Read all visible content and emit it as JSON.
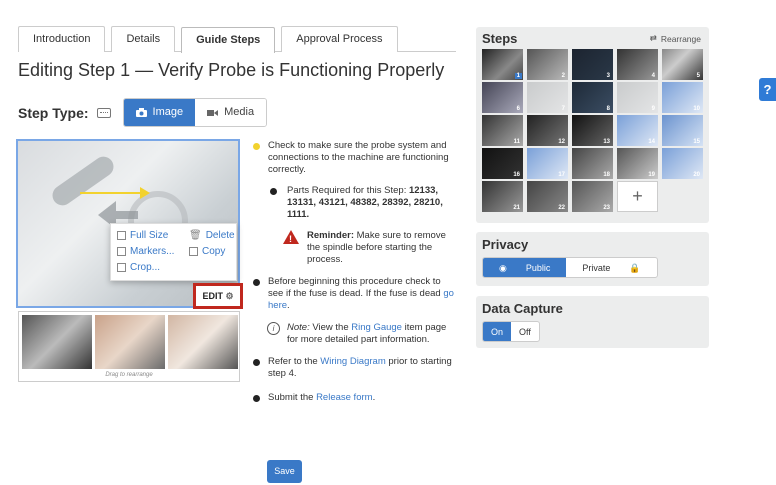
{
  "tabs": [
    {
      "label": "Introduction"
    },
    {
      "label": "Details"
    },
    {
      "label": "Guide Steps",
      "active": true
    },
    {
      "label": "Approval Process"
    }
  ],
  "title": "Editing Step 1 — Verify Probe is Functioning Properly",
  "step_type": {
    "label": "Step Type:",
    "options": [
      {
        "label": "Image",
        "selected": true
      },
      {
        "label": "Media",
        "selected": false
      }
    ]
  },
  "image_menu": {
    "full_size": "Full Size",
    "delete": "Delete",
    "markers": "Markers...",
    "copy": "Copy",
    "crop": "Crop...",
    "edit": "EDIT"
  },
  "drag_hint": "Drag to rearrange",
  "content": {
    "b1": "Check to make sure the probe system and connections to the machine are functioning correctly.",
    "parts_prefix": "Parts Required for this Step: ",
    "parts": "12133, 13131, 43121, 48382, 28392, 28210, 1111.",
    "reminder_label": "Reminder:",
    "reminder_text": " Make sure to remove the spindle before starting the process.",
    "b2_pre": "Before beginning this procedure check to see if the fuse is dead. If the fuse is dead ",
    "b2_link": "go here",
    "b2_post": ".",
    "note_label": "Note:",
    "note_pre": " View the ",
    "note_link": "Ring Gauge",
    "note_post": " item page for more detailed part information.",
    "b3_pre": "Refer to the ",
    "b3_link": "Wiring Diagram",
    "b3_post": " prior to starting step 4.",
    "b4_pre": "Submit the ",
    "b4_link": "Release form",
    "b4_post": "."
  },
  "save": "Save",
  "steps_panel": {
    "title": "Steps",
    "rearrange": "Rearrange",
    "steps": [
      "1",
      "2",
      "3",
      "4",
      "5",
      "6",
      "7",
      "8",
      "9",
      "10",
      "11",
      "12",
      "13",
      "14",
      "15",
      "16",
      "17",
      "18",
      "19",
      "20",
      "21",
      "22",
      "23"
    ],
    "add": "+"
  },
  "privacy": {
    "title": "Privacy",
    "options": [
      "Public",
      "Private"
    ],
    "selected": "Public"
  },
  "data_capture": {
    "title": "Data Capture",
    "options": [
      "On",
      "Off"
    ],
    "selected": "On"
  },
  "help": "?",
  "colors": {
    "accent": "#3a79c7",
    "edit_border": "#c0281e",
    "bullet_highlight": "#f2d22e"
  }
}
